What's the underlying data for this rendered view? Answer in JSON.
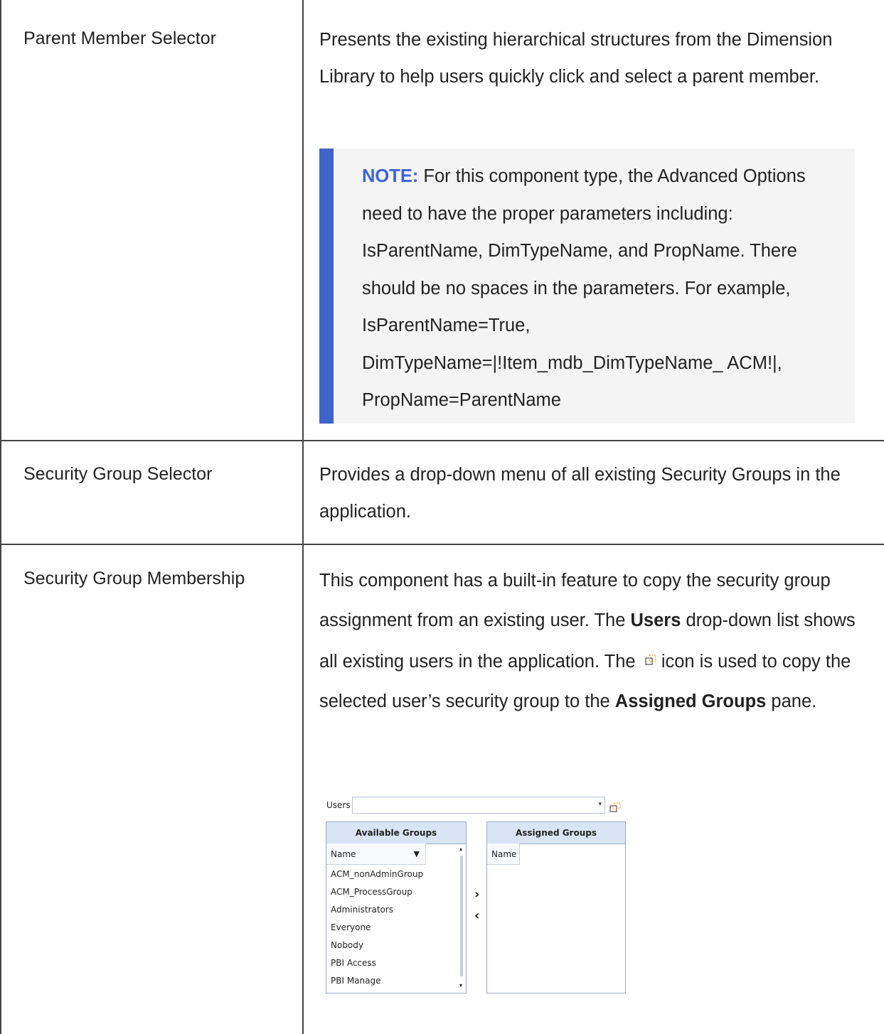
{
  "rows": [
    {
      "name": "Parent Member Selector",
      "description": "Presents the existing hierarchical structures from the Dimension Library to help users quickly click and select a parent member.",
      "note": {
        "label": "NOTE:",
        "text": "For this component type, the Advanced Options need to have the proper parameters including: IsParentName, DimTypeName, and PropName. There should be no spaces in the parameters. For example, IsParentName=True, DimTypeName=|!Item_mdb_DimTypeName_ ACM!|, PropName=ParentName"
      }
    },
    {
      "name": "Security Group Selector",
      "description": "Provides a drop-down menu of all existing Security Groups in the application."
    },
    {
      "name": "Security Group Membership",
      "description_part1": "This component has a built-in feature to copy the security group assignment from an existing user. The",
      "description_bold1": "Users",
      "description_part2": "drop-down list shows all existing users in the application. The",
      "description_part3": "icon is used to copy the selected user’s security group to the",
      "description_bold2": "Assigned Groups",
      "description_part4": "pane."
    }
  ],
  "screenshot": {
    "users_label": "Users",
    "available_title": "Available Groups",
    "assigned_title": "Assigned Groups",
    "name_col": "Name",
    "available_items": [
      "ACM_nonAdminGroup",
      "ACM_ProcessGroup",
      "Administrators",
      "Everyone",
      "Nobody",
      "PBI Access",
      "PBI Manage"
    ],
    "move_right": "›",
    "move_left": "‹"
  },
  "colors": {
    "note_bar": "#3e63c9",
    "note_label": "#3a63d6",
    "pane_header": "#d9e5f6",
    "copy_icon": "#e8a13a"
  }
}
